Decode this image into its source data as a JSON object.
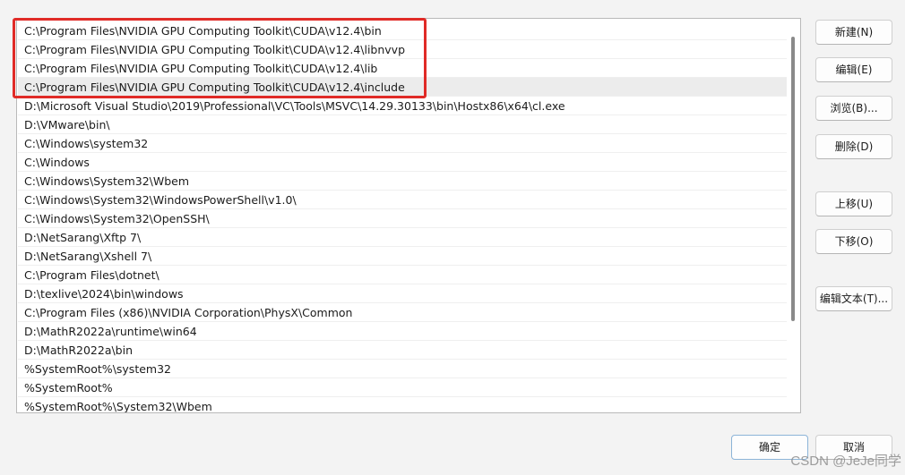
{
  "path_list": {
    "items": [
      "C:\\Program Files\\NVIDIA GPU Computing Toolkit\\CUDA\\v12.4\\bin",
      "C:\\Program Files\\NVIDIA GPU Computing Toolkit\\CUDA\\v12.4\\libnvvp",
      "C:\\Program Files\\NVIDIA GPU Computing Toolkit\\CUDA\\v12.4\\lib",
      "C:\\Program Files\\NVIDIA GPU Computing Toolkit\\CUDA\\v12.4\\include",
      "D:\\Microsoft Visual Studio\\2019\\Professional\\VC\\Tools\\MSVC\\14.29.30133\\bin\\Hostx86\\x64\\cl.exe",
      "D:\\VMware\\bin\\",
      "C:\\Windows\\system32",
      "C:\\Windows",
      "C:\\Windows\\System32\\Wbem",
      "C:\\Windows\\System32\\WindowsPowerShell\\v1.0\\",
      "C:\\Windows\\System32\\OpenSSH\\",
      "D:\\NetSarang\\Xftp 7\\",
      "D:\\NetSarang\\Xshell 7\\",
      "C:\\Program Files\\dotnet\\",
      "D:\\texlive\\2024\\bin\\windows",
      "C:\\Program Files (x86)\\NVIDIA Corporation\\PhysX\\Common",
      "D:\\MathR2022a\\runtime\\win64",
      "D:\\MathR2022a\\bin",
      "%SystemRoot%\\system32",
      "%SystemRoot%",
      "%SystemRoot%\\System32\\Wbem"
    ]
  },
  "buttons": {
    "new": "新建(N)",
    "edit": "编辑(E)",
    "browse": "浏览(B)...",
    "delete": "删除(D)",
    "move_up": "上移(U)",
    "move_down": "下移(O)",
    "edit_text": "编辑文本(T)...",
    "ok": "确定",
    "cancel": "取消"
  },
  "watermark": "CSDN @JeJe同学",
  "colors": {
    "highlight_border": "#e02b27",
    "selected_row": "#ececec",
    "window_bg": "#f3f3f3"
  }
}
